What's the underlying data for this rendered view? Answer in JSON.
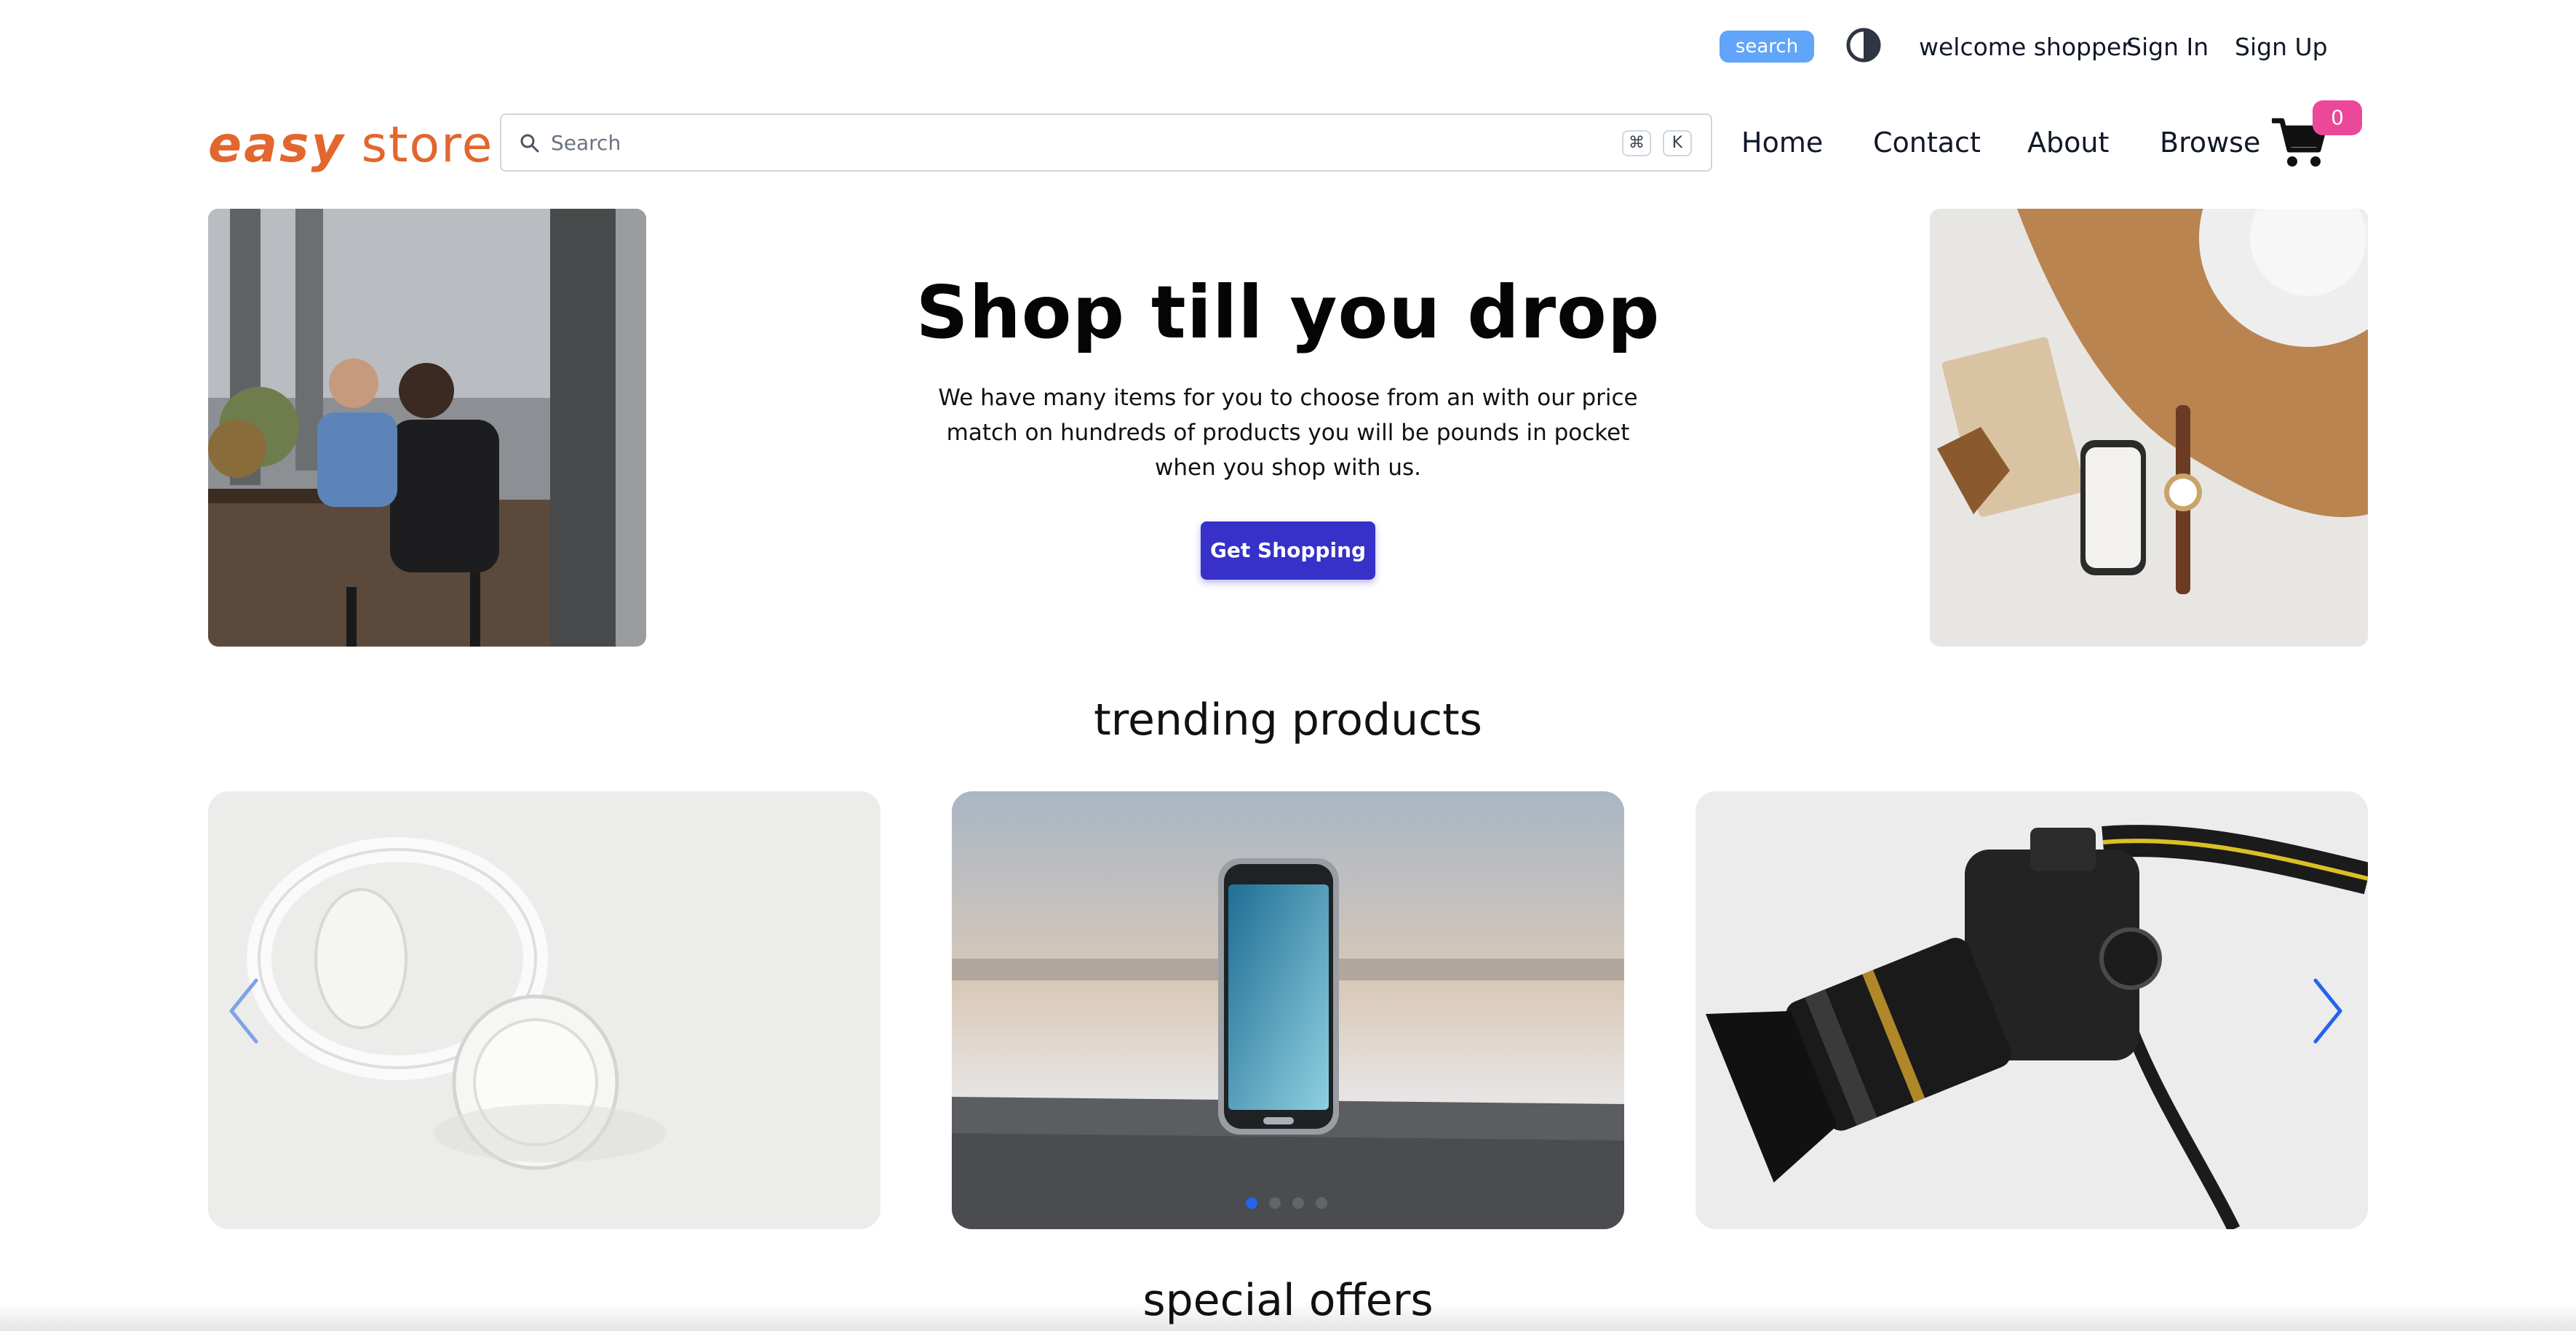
{
  "topbar": {
    "search_label": "search",
    "welcome": "welcome shopper",
    "sign_in": "Sign In",
    "sign_up": "Sign Up"
  },
  "header": {
    "logo_bold": "easy",
    "logo_regular": "store",
    "search_placeholder": "Search",
    "shortcut_key_1": "⌘",
    "shortcut_key_2": "K",
    "nav": [
      "Home",
      "Contact",
      "About",
      "Browse"
    ],
    "cart_count": "0"
  },
  "hero": {
    "title": "Shop till you drop",
    "text": "We have many items for you to choose from an with our price match on hundreds of products you will be pounds in pocket when you shop with us.",
    "cta": "Get Shopping"
  },
  "sections": {
    "trending": "trending products",
    "offers": "special offers"
  },
  "carousel": {
    "slides": [
      "headphones",
      "smartphone",
      "camera"
    ],
    "dots": 4,
    "active_dot": 1
  },
  "colors": {
    "logo": "#e2662e",
    "search_pill": "#60a5fa",
    "cta": "#3730c9",
    "cart_badge": "#ec4899",
    "carousel_arrow": "#2563eb"
  },
  "icons": [
    "search-icon",
    "theme-toggle-icon",
    "cart-icon",
    "chevron-left-icon",
    "chevron-right-icon"
  ]
}
